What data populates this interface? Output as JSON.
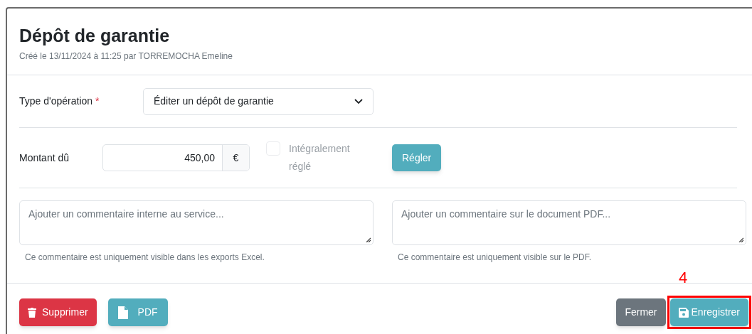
{
  "modal": {
    "title": "Dépôt de garantie",
    "subtitle": "Créé le 13/11/2024 à 11:25 par TORREMOCHA Emeline"
  },
  "operation": {
    "label": "Type d'opération",
    "required_mark": "*",
    "value": "Éditer un dépôt de garantie"
  },
  "amount": {
    "label": "Montant dû",
    "value": "450,00",
    "currency": "€",
    "paid_checkbox": {
      "label": "Intégralement réglé",
      "checked": false,
      "disabled": true
    },
    "pay_button": "Régler"
  },
  "comments": [
    {
      "placeholder": "Ajouter un commentaire interne au service...",
      "help": "Ce commentaire est uniquement visible dans les exports Excel."
    },
    {
      "placeholder": "Ajouter un commentaire sur le document PDF...",
      "help": "Ce commentaire est uniquement visible sur le PDF."
    }
  ],
  "footer_buttons": [
    {
      "kind": "delete",
      "label": "Supprimer"
    },
    {
      "kind": "pdf",
      "label": "PDF"
    },
    {
      "kind": "close",
      "label": "Fermer"
    },
    {
      "kind": "save",
      "label": "Enregistrer",
      "highlighted": true
    }
  ],
  "annotation": {
    "label": "4"
  }
}
